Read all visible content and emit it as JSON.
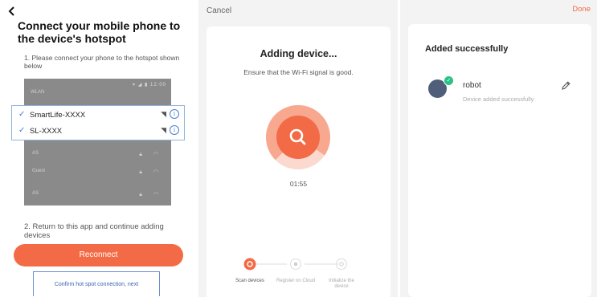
{
  "connect_screen": {
    "title": "Connect your mobile phone to the device's hotspot",
    "step1": "1. Please connect your phone to the hotspot shown below",
    "phone_status": "▾ ◢ ▮ 12:00",
    "phone_wlan_label": "WLAN",
    "hotspots": [
      {
        "name": "SmartLife-XXXX",
        "wifi_icon": "wifi-icon",
        "info_icon": "info-icon"
      },
      {
        "name": "SL-XXXX",
        "wifi_icon": "wifi-icon",
        "info_icon": "info-icon"
      }
    ],
    "other_networks": [
      "AS",
      "Guest",
      "AS"
    ],
    "step2": "2. Return to this app and continue adding devices",
    "reconnect_label": "Reconnect",
    "confirm_label": "Confirm hot spot connection, next"
  },
  "adding_screen": {
    "cancel_label": "Cancel",
    "title": "Adding device...",
    "subtitle": "Ensure that the Wi-Fi signal is good.",
    "timer": "01:55",
    "progress_fraction": 0.72,
    "steps": [
      {
        "label": "Scan devices",
        "active": true
      },
      {
        "label": "Register on Cloud",
        "active": false
      },
      {
        "label": "Initialize the device",
        "active": false
      }
    ]
  },
  "success_screen": {
    "done_label": "Done",
    "title": "Added successfully",
    "device_name": "robot",
    "device_status": "Device added successfully"
  },
  "colors": {
    "accent": "#f36b46",
    "accent_light": "#f7a88f",
    "success": "#28c286",
    "link_blue": "#3c63b3"
  }
}
